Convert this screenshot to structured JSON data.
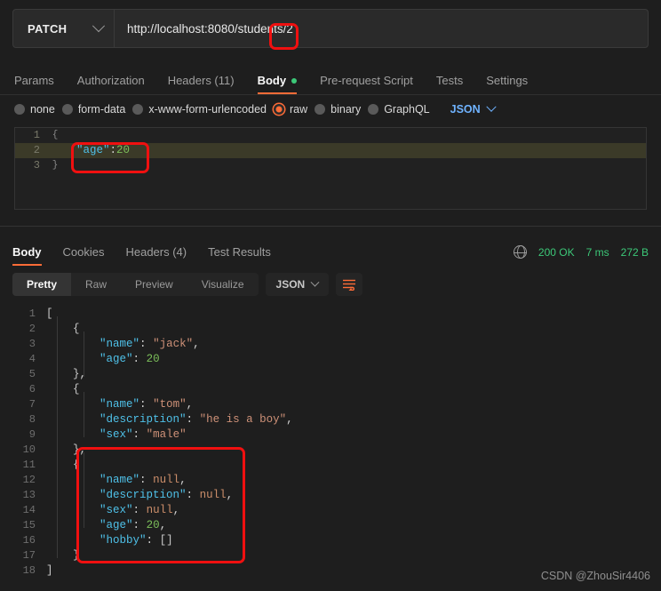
{
  "request": {
    "method": "PATCH",
    "url": "http://localhost:8080/students/2",
    "tabs": [
      {
        "label": "Params",
        "active": false,
        "dot": false
      },
      {
        "label": "Authorization",
        "active": false,
        "dot": false
      },
      {
        "label": "Headers (11)",
        "active": false,
        "dot": false
      },
      {
        "label": "Body",
        "active": true,
        "dot": true
      },
      {
        "label": "Pre-request Script",
        "active": false,
        "dot": false
      },
      {
        "label": "Tests",
        "active": false,
        "dot": false
      },
      {
        "label": "Settings",
        "active": false,
        "dot": false
      }
    ],
    "body_types": [
      {
        "label": "none",
        "selected": false
      },
      {
        "label": "form-data",
        "selected": false
      },
      {
        "label": "x-www-form-urlencoded",
        "selected": false
      },
      {
        "label": "raw",
        "selected": true
      },
      {
        "label": "binary",
        "selected": false
      },
      {
        "label": "GraphQL",
        "selected": false
      }
    ],
    "format": "JSON",
    "body_lines": [
      {
        "num": "1",
        "fold": "{",
        "text": "{",
        "highlight": false
      },
      {
        "num": "2",
        "fold": "",
        "text": "\"age\":20",
        "highlight": true
      },
      {
        "num": "3",
        "fold": "}",
        "text": "}",
        "highlight": false
      }
    ]
  },
  "response": {
    "tabs": [
      {
        "label": "Body",
        "active": true
      },
      {
        "label": "Cookies",
        "active": false
      },
      {
        "label": "Headers (4)",
        "active": false
      },
      {
        "label": "Test Results",
        "active": false
      }
    ],
    "status": {
      "code": "200 OK",
      "time": "7 ms",
      "size": "272 B"
    },
    "views": [
      {
        "label": "Pretty",
        "active": true
      },
      {
        "label": "Raw",
        "active": false
      },
      {
        "label": "Preview",
        "active": false
      },
      {
        "label": "Visualize",
        "active": false
      }
    ],
    "format": "JSON",
    "body_lines": [
      {
        "num": "1",
        "text": "["
      },
      {
        "num": "2",
        "text": "    {"
      },
      {
        "num": "3",
        "text": "        \"name\": \"jack\","
      },
      {
        "num": "4",
        "text": "        \"age\": 20"
      },
      {
        "num": "5",
        "text": "    },"
      },
      {
        "num": "6",
        "text": "    {"
      },
      {
        "num": "7",
        "text": "        \"name\": \"tom\","
      },
      {
        "num": "8",
        "text": "        \"description\": \"he is a boy\","
      },
      {
        "num": "9",
        "text": "        \"sex\": \"male\""
      },
      {
        "num": "10",
        "text": "    },"
      },
      {
        "num": "11",
        "text": "    {"
      },
      {
        "num": "12",
        "text": "        \"name\": null,"
      },
      {
        "num": "13",
        "text": "        \"description\": null,"
      },
      {
        "num": "14",
        "text": "        \"sex\": null,"
      },
      {
        "num": "15",
        "text": "        \"age\": 20,"
      },
      {
        "num": "16",
        "text": "        \"hobby\": []"
      },
      {
        "num": "17",
        "text": "    }"
      },
      {
        "num": "18",
        "text": "]"
      }
    ],
    "json_value": [
      {
        "name": "jack",
        "age": 20
      },
      {
        "name": "tom",
        "description": "he is a boy",
        "sex": "male"
      },
      {
        "name": null,
        "description": null,
        "sex": null,
        "age": 20,
        "hobby": []
      }
    ]
  },
  "annotations": {
    "color": "#f01010",
    "boxes": [
      {
        "target": "url-path-id"
      },
      {
        "target": "request-body-age"
      },
      {
        "target": "response-third-object"
      }
    ]
  },
  "watermark": "CSDN @ZhouSir4406",
  "icons": {
    "method_chevron": "chevron-down-icon",
    "format_chevron": "chevron-down-icon",
    "globe": "globe-icon",
    "wrap": "word-wrap-icon"
  }
}
